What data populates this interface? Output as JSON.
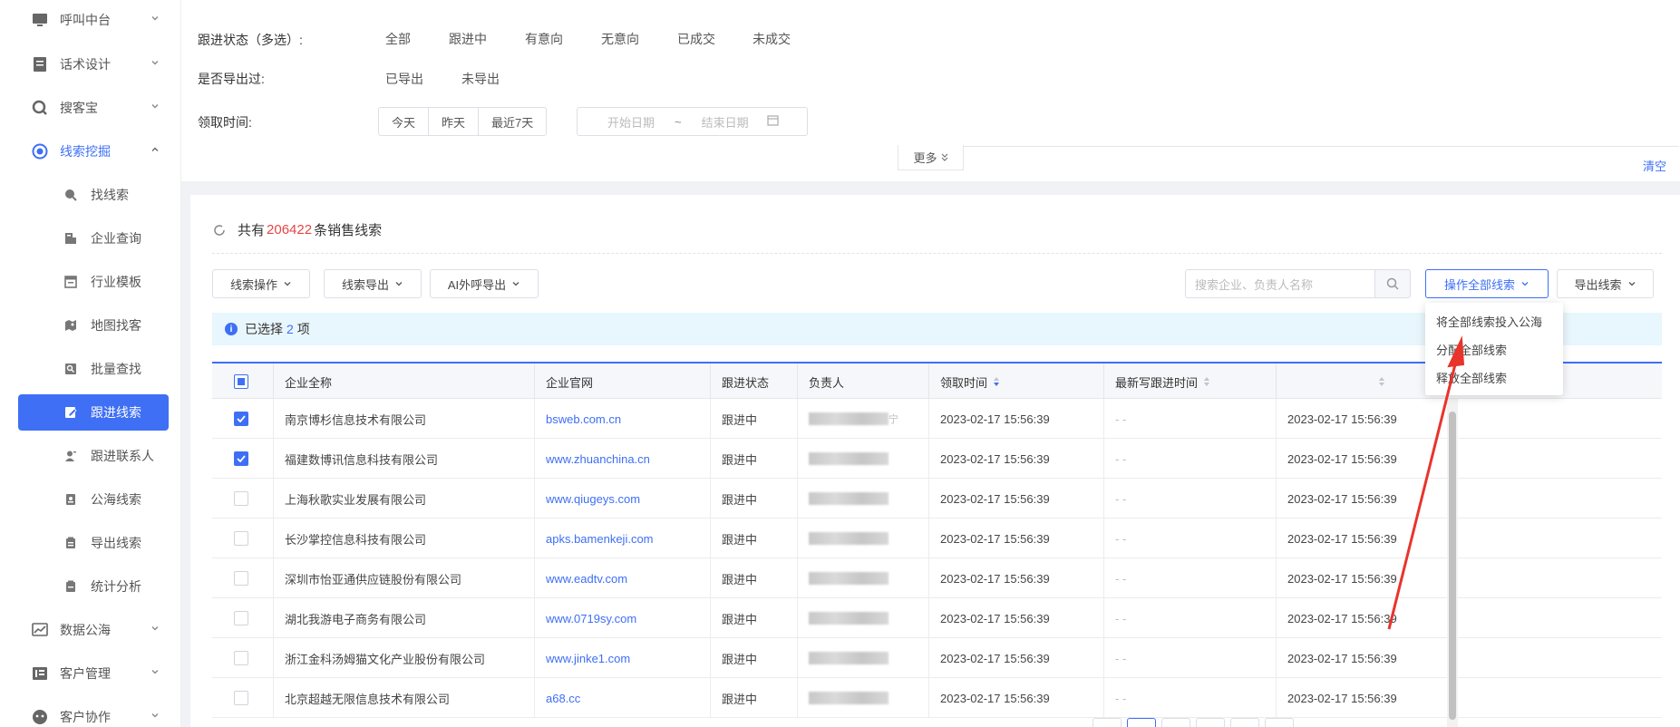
{
  "sidebar": {
    "items": [
      {
        "label": "呼叫中台",
        "icon": "monitor-icon"
      },
      {
        "label": "话术设计",
        "icon": "script-icon"
      },
      {
        "label": "搜客宝",
        "icon": "search-customer-icon"
      },
      {
        "label": "线索挖掘",
        "icon": "target-icon"
      },
      {
        "label": "数据公海",
        "icon": "chart-icon"
      },
      {
        "label": "客户管理",
        "icon": "customer-icon"
      },
      {
        "label": "客户协作",
        "icon": "collab-icon"
      }
    ],
    "sub_items": [
      {
        "label": "找线索",
        "icon": "magnifier-icon"
      },
      {
        "label": "企业查询",
        "icon": "building-icon"
      },
      {
        "label": "行业模板",
        "icon": "template-icon"
      },
      {
        "label": "地图找客",
        "icon": "map-icon"
      },
      {
        "label": "批量查找",
        "icon": "batch-search-icon"
      },
      {
        "label": "跟进线索",
        "icon": "edit-icon"
      },
      {
        "label": "跟进联系人",
        "icon": "contact-icon"
      },
      {
        "label": "公海线索",
        "icon": "pool-icon"
      },
      {
        "label": "导出线索",
        "icon": "export-icon"
      },
      {
        "label": "统计分析",
        "icon": "stats-icon"
      }
    ]
  },
  "filters": {
    "status_label": "跟进状态（多选）:",
    "status_options": [
      "全部",
      "跟进中",
      "有意向",
      "无意向",
      "已成交",
      "未成交"
    ],
    "exported_label": "是否导出过:",
    "exported_options": [
      "已导出",
      "未导出"
    ],
    "time_label": "领取时间:",
    "time_options": [
      "今天",
      "昨天",
      "最近7天"
    ],
    "date_start": "开始日期",
    "date_sep": "~",
    "date_end": "结束日期",
    "more": "更多",
    "clear": "清空"
  },
  "summary": {
    "prefix": "共有",
    "count": "206422",
    "suffix": "条销售线索"
  },
  "toolbar": {
    "lead_ops": "线索操作",
    "lead_export": "线索导出",
    "ai_export": "AI外呼导出",
    "search_placeholder": "搜索企业、负责人名称",
    "op_all": "操作全部线索",
    "export_leads": "导出线索"
  },
  "dropdown": {
    "items": [
      "将全部线索投入公海",
      "分配全部线索",
      "释放全部线索"
    ]
  },
  "selection": {
    "prefix": "已选择",
    "count": "2",
    "suffix": "项"
  },
  "table": {
    "headers": [
      "企业全称",
      "企业官网",
      "跟进状态",
      "负责人",
      "领取时间",
      "最新写跟进时间"
    ],
    "rows": [
      {
        "checked": true,
        "company": "南京博杉信息技术有限公司",
        "site": "bsweb.com.cn",
        "status": "跟进中",
        "owner_tail": "宁",
        "time": "2023-02-17 15:56:39",
        "last": "- -",
        "extra": "2023-02-17 15:56:39"
      },
      {
        "checked": true,
        "company": "福建数博讯信息科技有限公司",
        "site": "www.zhuanchina.cn",
        "status": "跟进中",
        "owner_tail": "",
        "time": "2023-02-17 15:56:39",
        "last": "- -",
        "extra": "2023-02-17 15:56:39"
      },
      {
        "checked": false,
        "company": "上海秋歌实业发展有限公司",
        "site": "www.qiugeys.com",
        "status": "跟进中",
        "owner_tail": "",
        "time": "2023-02-17 15:56:39",
        "last": "- -",
        "extra": "2023-02-17 15:56:39"
      },
      {
        "checked": false,
        "company": "长沙掌控信息科技有限公司",
        "site": "apks.bamenkeji.com",
        "status": "跟进中",
        "owner_tail": "",
        "time": "2023-02-17 15:56:39",
        "last": "- -",
        "extra": "2023-02-17 15:56:39"
      },
      {
        "checked": false,
        "company": "深圳市怡亚通供应链股份有限公司",
        "site": "www.eadtv.com",
        "status": "跟进中",
        "owner_tail": "",
        "time": "2023-02-17 15:56:39",
        "last": "- -",
        "extra": "2023-02-17 15:56:39"
      },
      {
        "checked": false,
        "company": "湖北我游电子商务有限公司",
        "site": "www.0719sy.com",
        "status": "跟进中",
        "owner_tail": "",
        "time": "2023-02-17 15:56:39",
        "last": "- -",
        "extra": "2023-02-17 15:56:39"
      },
      {
        "checked": false,
        "company": "浙江金科汤姆猫文化产业股份有限公司",
        "site": "www.jinke1.com",
        "status": "跟进中",
        "owner_tail": "",
        "time": "2023-02-17 15:56:39",
        "last": "- -",
        "extra": "2023-02-17 15:56:39"
      },
      {
        "checked": false,
        "company": "北京超越无限信息技术有限公司",
        "site": "a68.cc",
        "status": "跟进中",
        "owner_tail": "",
        "time": "2023-02-17 15:56:39",
        "last": "- -",
        "extra": "2023-02-17 15:56:39"
      }
    ]
  },
  "colors": {
    "accent": "#3e6ff5",
    "count_red": "#e64545",
    "arrow_red": "#e8342b"
  }
}
